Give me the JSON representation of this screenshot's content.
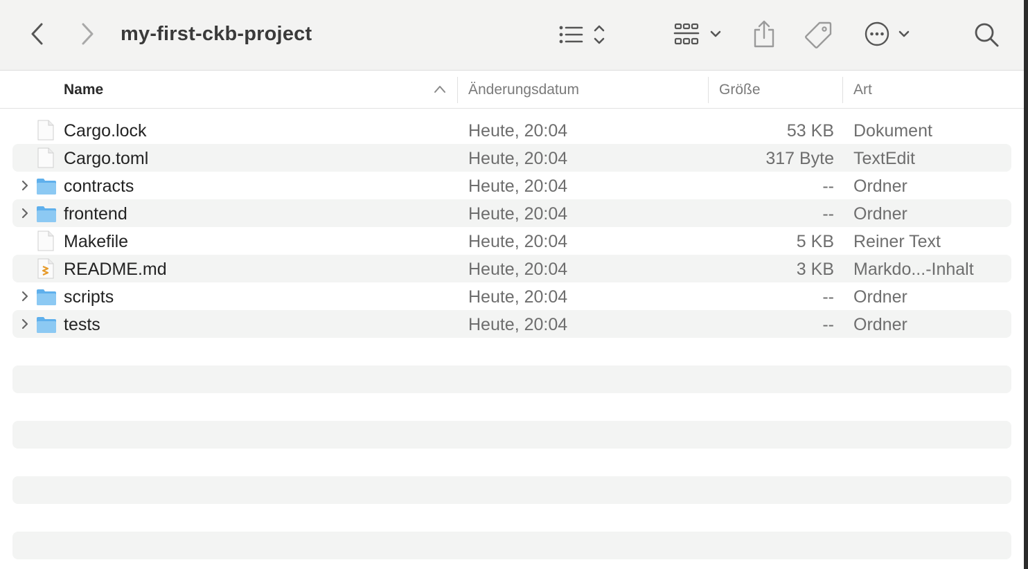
{
  "toolbar": {
    "title": "my-first-ckb-project",
    "icons": [
      "back-icon",
      "forward-icon",
      "list-view-icon",
      "group-icon",
      "share-icon",
      "tag-icon",
      "more-icon",
      "search-icon"
    ]
  },
  "columns": {
    "name": "Name",
    "date": "Änderungsdatum",
    "size": "Größe",
    "kind": "Art"
  },
  "files": [
    {
      "name": "Cargo.lock",
      "date": "Heute, 20:04",
      "size": "53 KB",
      "kind": "Dokument",
      "icon": "document-icon",
      "folder": false
    },
    {
      "name": "Cargo.toml",
      "date": "Heute, 20:04",
      "size": "317 Byte",
      "kind": "TextEdit",
      "icon": "document-icon",
      "folder": false
    },
    {
      "name": "contracts",
      "date": "Heute, 20:04",
      "size": "--",
      "kind": "Ordner",
      "icon": "folder-icon",
      "folder": true
    },
    {
      "name": "frontend",
      "date": "Heute, 20:04",
      "size": "--",
      "kind": "Ordner",
      "icon": "folder-icon",
      "folder": true
    },
    {
      "name": "Makefile",
      "date": "Heute, 20:04",
      "size": "5 KB",
      "kind": "Reiner Text",
      "icon": "document-icon",
      "folder": false
    },
    {
      "name": "README.md",
      "date": "Heute, 20:04",
      "size": "3 KB",
      "kind": "Markdo...-Inhalt",
      "icon": "markdown-file-icon",
      "folder": false
    },
    {
      "name": "scripts",
      "date": "Heute, 20:04",
      "size": "--",
      "kind": "Ordner",
      "icon": "folder-icon",
      "folder": true
    },
    {
      "name": "tests",
      "date": "Heute, 20:04",
      "size": "--",
      "kind": "Ordner",
      "icon": "folder-icon",
      "folder": true
    }
  ],
  "colors": {
    "folder": "#5fb0ec",
    "folder_tab": "#8cc9f3",
    "stripe": "#f3f4f3",
    "markdown_accent": "#e69a2a"
  }
}
